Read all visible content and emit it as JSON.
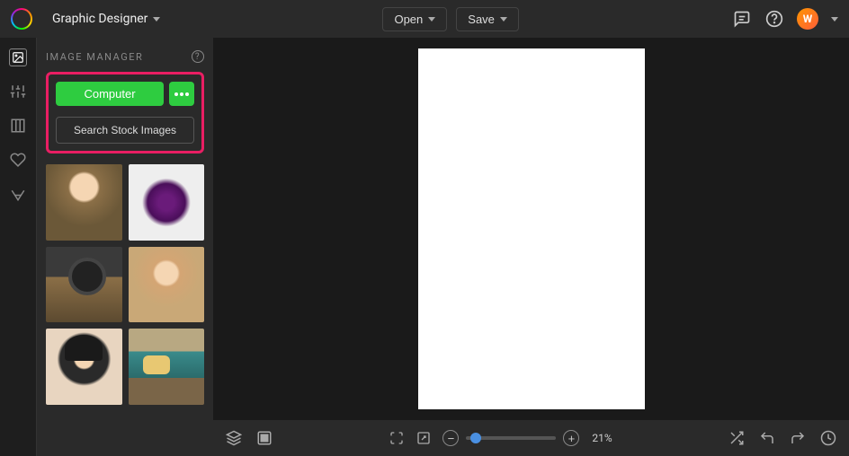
{
  "header": {
    "app_title": "Graphic Designer",
    "open_label": "Open",
    "save_label": "Save",
    "avatar_initial": "W"
  },
  "sidebar_rail": {
    "items": [
      {
        "name": "image-tool-icon"
      },
      {
        "name": "adjust-tool-icon"
      },
      {
        "name": "layout-tool-icon"
      },
      {
        "name": "favorites-tool-icon"
      },
      {
        "name": "text-tool-icon"
      }
    ]
  },
  "image_manager": {
    "title": "IMAGE MANAGER",
    "computer_btn": "Computer",
    "stock_btn": "Search Stock Images",
    "thumbnails": [
      {
        "name": "woman-portrait"
      },
      {
        "name": "purple-flower"
      },
      {
        "name": "vintage-camera"
      },
      {
        "name": "woman-hat"
      },
      {
        "name": "woman-black-hat"
      },
      {
        "name": "teal-truck"
      }
    ]
  },
  "bottombar": {
    "zoom_pct": "21%"
  }
}
